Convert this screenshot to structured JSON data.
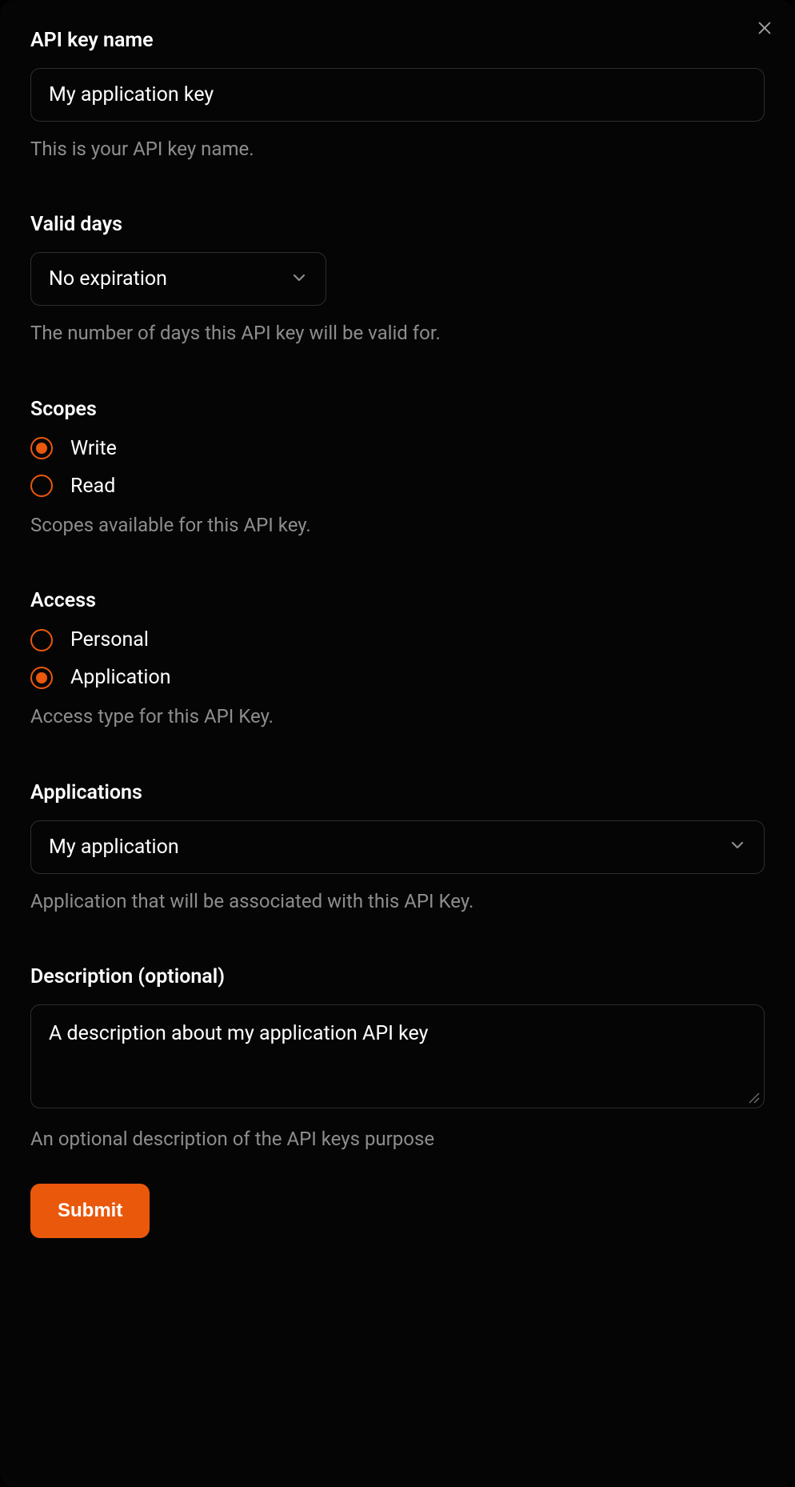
{
  "name_field": {
    "label": "API key name",
    "value": "My application key",
    "help": "This is your API key name."
  },
  "valid_days_field": {
    "label": "Valid days",
    "value": "No expiration",
    "help": "The number of days this API key will be valid for."
  },
  "scopes_field": {
    "label": "Scopes",
    "options": [
      {
        "label": "Write",
        "checked": true
      },
      {
        "label": "Read",
        "checked": false
      }
    ],
    "help": "Scopes available for this API key."
  },
  "access_field": {
    "label": "Access",
    "options": [
      {
        "label": "Personal",
        "checked": false
      },
      {
        "label": "Application",
        "checked": true
      }
    ],
    "help": "Access type for this API Key."
  },
  "applications_field": {
    "label": "Applications",
    "value": "My application",
    "help": "Application that will be associated with this API Key."
  },
  "description_field": {
    "label": "Description (optional)",
    "value": "A description about my application API key",
    "help": "An optional description of the API keys purpose"
  },
  "submit_label": "Submit"
}
